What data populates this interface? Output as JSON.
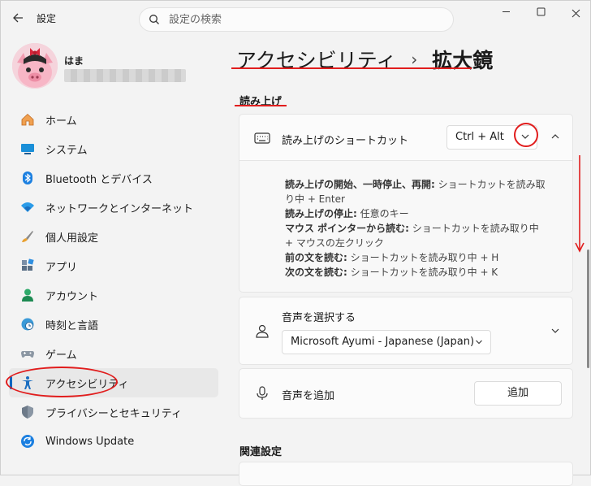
{
  "window": {
    "title": "設定",
    "search_placeholder": "設定の検索"
  },
  "profile": {
    "name": "はま"
  },
  "sidebar": {
    "items": [
      {
        "label": "ホーム",
        "icon": "home-icon"
      },
      {
        "label": "システム",
        "icon": "monitor-icon"
      },
      {
        "label": "Bluetooth とデバイス",
        "icon": "bluetooth-icon"
      },
      {
        "label": "ネットワークとインターネット",
        "icon": "wifi-icon"
      },
      {
        "label": "個人用設定",
        "icon": "brush-icon"
      },
      {
        "label": "アプリ",
        "icon": "apps-icon"
      },
      {
        "label": "アカウント",
        "icon": "person-icon"
      },
      {
        "label": "時刻と言語",
        "icon": "clock-globe-icon"
      },
      {
        "label": "ゲーム",
        "icon": "gamepad-icon"
      },
      {
        "label": "アクセシビリティ",
        "icon": "accessibility-icon",
        "active": true
      },
      {
        "label": "プライバシーとセキュリティ",
        "icon": "shield-icon"
      },
      {
        "label": "Windows Update",
        "icon": "update-icon"
      }
    ]
  },
  "breadcrumb": {
    "parent": "アクセシビリティ",
    "separator": "›",
    "current": "拡大鏡"
  },
  "section": {
    "title": "読み上げ"
  },
  "shortcut": {
    "label": "読み上げのショートカット",
    "value": "Ctrl + Alt",
    "description": [
      {
        "bold": "読み上げの開始、一時停止、再開:",
        "text": " ショートカットを読み取り中 + Enter"
      },
      {
        "bold": "読み上げの停止:",
        "text": " 任意のキー"
      },
      {
        "bold": "マウス ポインターから読む:",
        "text": " ショートカットを読み取り中 + マウスの左クリック"
      },
      {
        "bold": "前の文を読む:",
        "text": " ショートカットを読み取り中 + H"
      },
      {
        "bold": "次の文を読む:",
        "text": " ショートカットを読み取り中 + K"
      }
    ]
  },
  "voice": {
    "label": "音声を選択する",
    "selected": "Microsoft Ayumi - Japanese (Japan)"
  },
  "add_voice": {
    "label": "音声を追加",
    "button": "追加"
  },
  "related": {
    "title": "関連設定"
  },
  "colors": {
    "accent": "#0067c0",
    "annotation": "#e11d1d"
  }
}
